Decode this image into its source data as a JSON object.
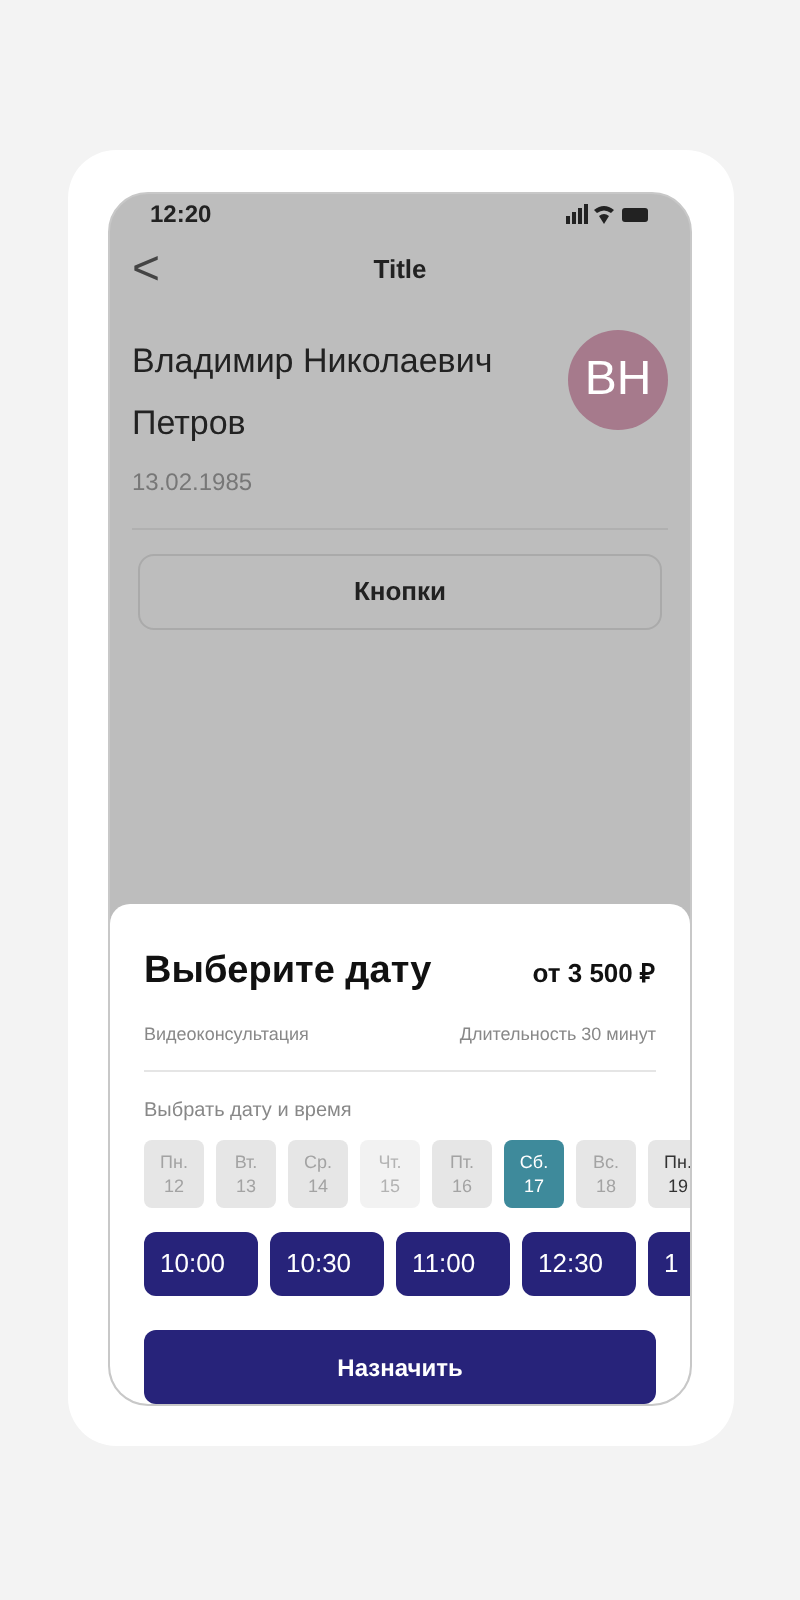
{
  "status_bar": {
    "time": "12:20"
  },
  "header": {
    "back": "<",
    "title": "Title"
  },
  "patient": {
    "name": "Владимир Николаевич Петров",
    "birth_date": "13.02.1985",
    "avatar": "ВН"
  },
  "action_button": "Кнопки",
  "sheet": {
    "title": "Выберите дату",
    "price": "от 3 500 ₽",
    "service": "Видеоконсультация",
    "duration": "Длительность 30 минут",
    "section_label": "Выбрать дату и время",
    "days": [
      {
        "weekday": "Пн.",
        "day": "12",
        "kind": "disabled",
        "selected": false
      },
      {
        "weekday": "Вт.",
        "day": "13",
        "kind": "disabled",
        "selected": false
      },
      {
        "weekday": "Ср.",
        "day": "14",
        "kind": "disabled",
        "selected": false
      },
      {
        "weekday": "Чт.",
        "day": "15",
        "kind": "closed",
        "selected": false
      },
      {
        "weekday": "Пт.",
        "day": "16",
        "kind": "disabled",
        "selected": false
      },
      {
        "weekday": "Сб.",
        "day": "17",
        "kind": "available",
        "selected": true
      },
      {
        "weekday": "Вс.",
        "day": "18",
        "kind": "disabled",
        "selected": false
      },
      {
        "weekday": "Пн.",
        "day": "19",
        "kind": "available",
        "selected": false
      }
    ],
    "times": [
      "10:00",
      "10:30",
      "11:00",
      "12:30",
      "1"
    ],
    "submit": "Назначить"
  }
}
